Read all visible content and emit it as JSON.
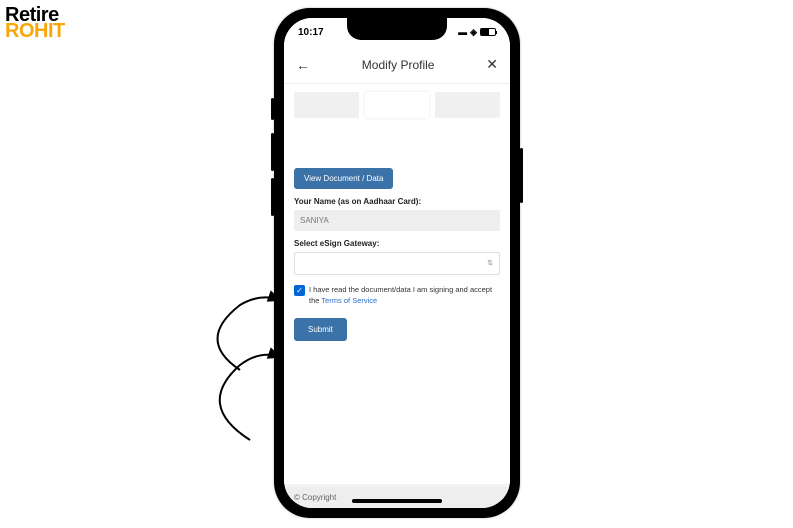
{
  "logo": {
    "top": "Retire",
    "bottom": "ROHIT"
  },
  "status": {
    "time": "10:17"
  },
  "header": {
    "title": "Modify Profile"
  },
  "buttons": {
    "view": "View Document / Data",
    "submit": "Submit"
  },
  "labels": {
    "name": "Your Name (as on Aadhaar Card):",
    "gateway": "Select eSign Gateway:"
  },
  "fields": {
    "name_value": "SANIYA"
  },
  "consent": {
    "text_pre": "I have read the document/data I am signing and accept the ",
    "tos": "Terms of Service"
  },
  "footer": {
    "copyright": "© Copyright"
  }
}
